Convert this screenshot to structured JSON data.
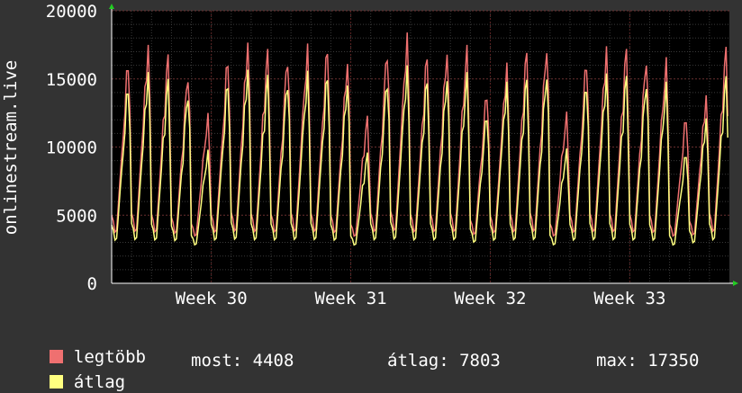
{
  "chart_data": {
    "type": "line",
    "ylabel": "onlinestream.live",
    "ylim": [
      0,
      20000
    ],
    "yticks": [
      "0",
      "5000",
      "10000",
      "15000",
      "20000"
    ],
    "xticks": [
      "Week 30",
      "Week 31",
      "Week 32",
      "Week 33"
    ],
    "colors": {
      "background": "#333333",
      "plot": "#000000",
      "grid": "#3a3a3a",
      "vgrid": "#5a2222",
      "max": "#ef7070",
      "avg": "#ffff80",
      "axis": "#ffffff",
      "arrow": "#22cc22"
    },
    "days": 31,
    "samples_per_day": 12,
    "series": [
      {
        "name": "legtöbb",
        "color": "#ef7070",
        "daily_peaks": [
          16500,
          17500,
          16800,
          15600,
          12500,
          16700,
          17800,
          17200,
          16900,
          17600,
          17500,
          16400,
          12300,
          17400,
          18400,
          16900,
          17300,
          17500,
          14300,
          16200,
          17200,
          17600,
          12600,
          16600,
          17400,
          17300,
          16800,
          16600,
          12400,
          13800,
          17350
        ]
      },
      {
        "name": "átlag",
        "color": "#ffff80",
        "daily_peaks": [
          14700,
          15500,
          15000,
          14200,
          9800,
          15000,
          15800,
          15300,
          15100,
          15600,
          15500,
          14800,
          9600,
          15200,
          16000,
          15100,
          15300,
          15500,
          12700,
          14800,
          15200,
          15600,
          9900,
          14900,
          15400,
          15300,
          15000,
          14800,
          9700,
          12100,
          15200
        ]
      }
    ]
  },
  "legend": {
    "max_label": "legtöbb",
    "avg_label": "átlag",
    "now_text": "most: 4408",
    "avg_text": "átlag: 7803",
    "max_text": "max: 17350"
  }
}
